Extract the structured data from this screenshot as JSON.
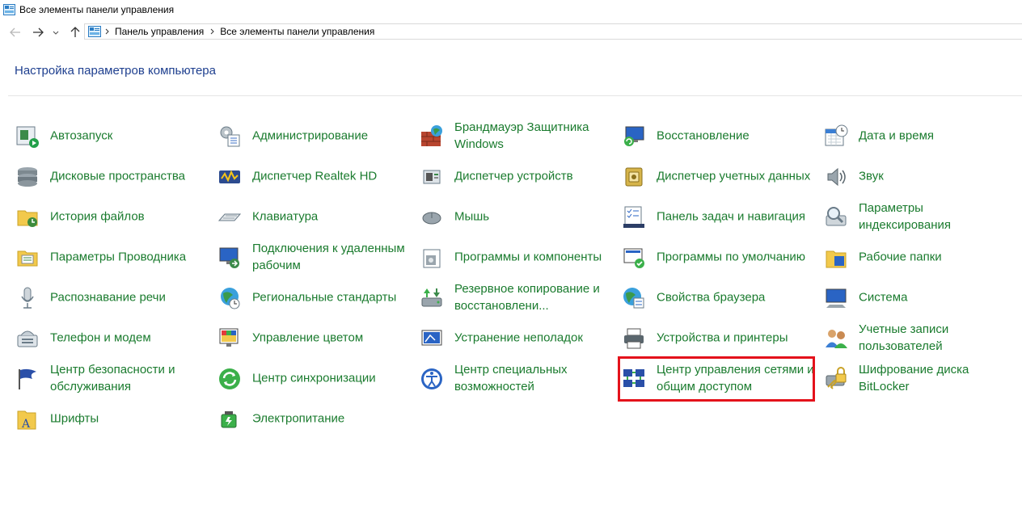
{
  "window": {
    "title": "Все элементы панели управления"
  },
  "address_bar": {
    "crumbs": [
      "Панель управления",
      "Все элементы панели управления"
    ]
  },
  "heading": "Настройка параметров компьютера",
  "highlight_color": "#e4121b",
  "link_color": "#1a7b2e",
  "columns": [
    [
      {
        "label": "Автозапуск",
        "icon": "autoplay-icon"
      },
      {
        "label": "Дисковые пространства",
        "icon": "storage-spaces-icon"
      },
      {
        "label": "История файлов",
        "icon": "file-history-icon"
      },
      {
        "label": "Параметры Проводника",
        "icon": "explorer-options-icon"
      },
      {
        "label": "Распознавание речи",
        "icon": "microphone-icon"
      },
      {
        "label": "Телефон и модем",
        "icon": "phone-modem-icon"
      },
      {
        "label": "Центр безопасности и обслуживания",
        "icon": "security-flag-icon"
      },
      {
        "label": "Шрифты",
        "icon": "fonts-icon"
      }
    ],
    [
      {
        "label": "Администрирование",
        "icon": "admin-tools-icon"
      },
      {
        "label": "Диспетчер Realtek HD",
        "icon": "realtek-icon"
      },
      {
        "label": "Клавиатура",
        "icon": "keyboard-icon"
      },
      {
        "label": "Подключения к удаленным рабочим",
        "icon": "remote-desktop-icon"
      },
      {
        "label": "Региональные стандарты",
        "icon": "region-globe-icon"
      },
      {
        "label": "Управление цветом",
        "icon": "color-management-icon"
      },
      {
        "label": "Центр синхронизации",
        "icon": "sync-center-icon"
      },
      {
        "label": "Электропитание",
        "icon": "power-options-icon"
      }
    ],
    [
      {
        "label": "Брандмауэр Защитника Windows",
        "icon": "firewall-icon"
      },
      {
        "label": "Диспетчер устройств",
        "icon": "device-manager-icon"
      },
      {
        "label": "Мышь",
        "icon": "mouse-icon"
      },
      {
        "label": "Программы и компоненты",
        "icon": "programs-features-icon"
      },
      {
        "label": "Резервное копирование и восстановлени...",
        "icon": "backup-restore-icon"
      },
      {
        "label": "Устранение неполадок",
        "icon": "troubleshooting-icon"
      },
      {
        "label": "Центр специальных возможностей",
        "icon": "ease-of-access-icon"
      }
    ],
    [
      {
        "label": "Восстановление",
        "icon": "recovery-icon"
      },
      {
        "label": "Диспетчер учетных данных",
        "icon": "credential-manager-icon"
      },
      {
        "label": "Панель задач и навигация",
        "icon": "taskbar-icon"
      },
      {
        "label": "Программы по умолчанию",
        "icon": "default-programs-icon"
      },
      {
        "label": "Свойства браузера",
        "icon": "internet-options-icon"
      },
      {
        "label": "Устройства и принтеры",
        "icon": "printer-icon"
      },
      {
        "label": "Центр управления сетями и общим доступом",
        "icon": "network-center-icon",
        "highlighted": true
      }
    ],
    [
      {
        "label": "Дата и время",
        "icon": "calendar-clock-icon"
      },
      {
        "label": "Звук",
        "icon": "speaker-icon"
      },
      {
        "label": "Параметры индексирования",
        "icon": "indexing-icon"
      },
      {
        "label": "Рабочие папки",
        "icon": "work-folders-icon"
      },
      {
        "label": "Система",
        "icon": "system-icon"
      },
      {
        "label": "Учетные записи пользователей",
        "icon": "user-accounts-icon"
      },
      {
        "label": "Шифрование диска BitLocker",
        "icon": "bitlocker-icon"
      }
    ]
  ]
}
